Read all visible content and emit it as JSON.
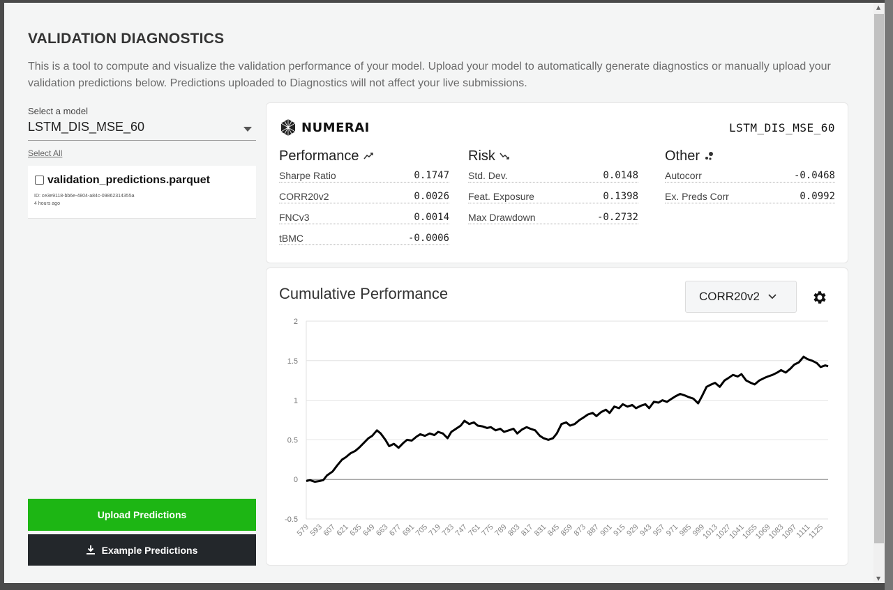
{
  "header": {
    "title": "VALIDATION DIAGNOSTICS",
    "description": "This is a tool to compute and visualize the validation performance of your model. Upload your model to automatically generate diagnostics or manually upload your validation predictions below. Predictions uploaded to Diagnostics will not affect your live submissions."
  },
  "sidebar": {
    "select_label": "Select a model",
    "selected_model": "LSTM_DIS_MSE_60",
    "select_all": "Select All",
    "file": {
      "name": "validation_predictions.parquet",
      "id": "ID: ce3e9118-bb6e-4804-a84c-09862314355a",
      "time": "4 hours ago",
      "checked": false
    },
    "upload_button": "Upload Predictions",
    "example_button": "Example Predictions"
  },
  "stats": {
    "brand": "NUMERAI",
    "model_name": "LSTM_DIS_MSE_60",
    "performance": {
      "title": "Performance",
      "rows": [
        {
          "label": "Sharpe Ratio",
          "value": "0.1747"
        },
        {
          "label": "CORR20v2",
          "value": "0.0026"
        },
        {
          "label": "FNCv3",
          "value": "0.0014"
        },
        {
          "label": "tBMC",
          "value": "-0.0006"
        }
      ]
    },
    "risk": {
      "title": "Risk",
      "rows": [
        {
          "label": "Std. Dev.",
          "value": "0.0148"
        },
        {
          "label": "Feat. Exposure",
          "value": "0.1398"
        },
        {
          "label": "Max Drawdown",
          "value": "-0.2732"
        }
      ]
    },
    "other": {
      "title": "Other",
      "rows": [
        {
          "label": "Autocorr",
          "value": "-0.0468"
        },
        {
          "label": "Ex. Preds Corr",
          "value": "0.0992"
        }
      ]
    }
  },
  "chart_panel": {
    "title": "Cumulative Performance",
    "metric": "CORR20v2"
  },
  "chart_data": {
    "type": "line",
    "title": "Cumulative Performance",
    "xlabel": "",
    "ylabel": "",
    "ylim": [
      -0.5,
      2
    ],
    "yticks": [
      -0.5,
      0,
      0.5,
      1,
      1.5,
      2
    ],
    "xticks": [
      579,
      593,
      607,
      621,
      635,
      649,
      663,
      677,
      691,
      705,
      719,
      733,
      747,
      761,
      775,
      789,
      803,
      817,
      831,
      845,
      859,
      873,
      887,
      901,
      915,
      929,
      943,
      957,
      971,
      985,
      999,
      1013,
      1027,
      1041,
      1055,
      1069,
      1083,
      1097,
      1111,
      1125
    ],
    "xlim": [
      579,
      1133
    ],
    "grid": true,
    "line_color": "#000000",
    "series": [
      {
        "x": [
          579,
          583,
          588,
          593,
          597,
          601,
          607,
          612,
          617,
          621,
          626,
          631,
          635,
          640,
          645,
          649,
          654,
          658,
          663,
          667,
          672,
          677,
          682,
          686,
          691,
          696,
          700,
          705,
          710,
          715,
          719,
          724,
          729,
          733,
          738,
          743,
          747,
          752,
          757,
          761,
          766,
          771,
          775,
          780,
          785,
          789,
          794,
          799,
          803,
          808,
          813,
          817,
          822,
          827,
          831,
          836,
          841,
          845,
          850,
          855,
          859,
          864,
          869,
          873,
          878,
          883,
          887,
          892,
          897,
          901,
          906,
          911,
          915,
          920,
          925,
          929,
          934,
          939,
          943,
          948,
          953,
          957,
          962,
          967,
          971,
          976,
          981,
          985,
          990,
          995,
          999,
          1004,
          1009,
          1013,
          1018,
          1023,
          1027,
          1032,
          1037,
          1041,
          1046,
          1051,
          1055,
          1060,
          1065,
          1069,
          1074,
          1079,
          1083,
          1088,
          1093,
          1097,
          1102,
          1107,
          1111,
          1116,
          1121,
          1125,
          1130,
          1133
        ],
        "y": [
          -0.02,
          -0.01,
          -0.03,
          -0.02,
          -0.01,
          0.05,
          0.1,
          0.18,
          0.25,
          0.28,
          0.33,
          0.36,
          0.4,
          0.46,
          0.52,
          0.55,
          0.62,
          0.58,
          0.5,
          0.42,
          0.45,
          0.4,
          0.46,
          0.5,
          0.49,
          0.54,
          0.57,
          0.55,
          0.58,
          0.56,
          0.6,
          0.58,
          0.52,
          0.6,
          0.64,
          0.68,
          0.74,
          0.7,
          0.72,
          0.68,
          0.67,
          0.65,
          0.66,
          0.62,
          0.64,
          0.6,
          0.62,
          0.64,
          0.58,
          0.63,
          0.66,
          0.64,
          0.62,
          0.55,
          0.52,
          0.5,
          0.52,
          0.58,
          0.7,
          0.72,
          0.68,
          0.7,
          0.75,
          0.78,
          0.82,
          0.84,
          0.8,
          0.85,
          0.88,
          0.84,
          0.92,
          0.9,
          0.95,
          0.92,
          0.94,
          0.9,
          0.93,
          0.95,
          0.9,
          0.98,
          0.97,
          1.0,
          0.98,
          1.02,
          1.05,
          1.08,
          1.06,
          1.04,
          1.02,
          0.96,
          1.05,
          1.17,
          1.2,
          1.22,
          1.17,
          1.25,
          1.28,
          1.32,
          1.3,
          1.33,
          1.25,
          1.22,
          1.2,
          1.25,
          1.28,
          1.3,
          1.32,
          1.35,
          1.38,
          1.35,
          1.4,
          1.45,
          1.48,
          1.55,
          1.52,
          1.5,
          1.47,
          1.42,
          1.44,
          1.43
        ]
      }
    ]
  },
  "icons": {
    "performance": "trending-up-icon",
    "risk": "trending-down-icon",
    "other": "scatter-icon",
    "gear": "gear-icon",
    "download": "download-icon"
  },
  "colors": {
    "upload_button": "#1db614",
    "example_button": "#23272b"
  }
}
